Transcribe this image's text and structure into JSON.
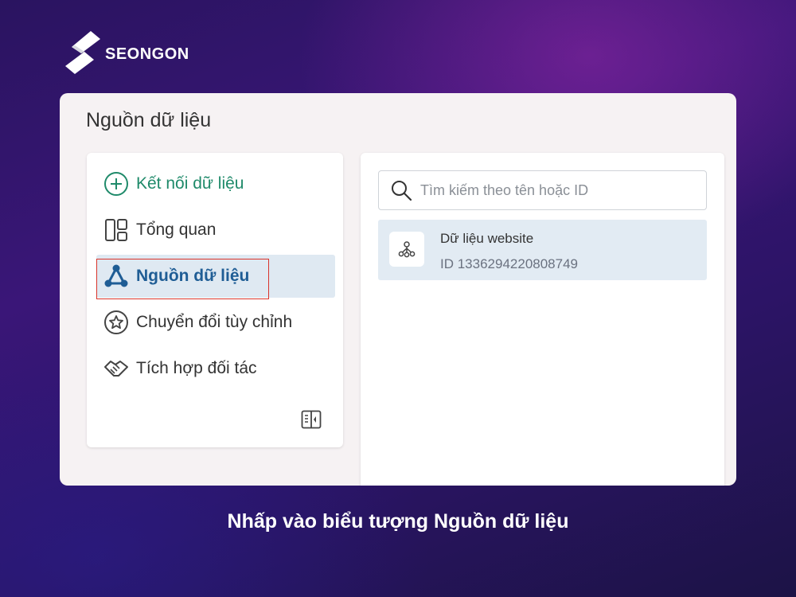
{
  "brand": {
    "name": "SEONGON"
  },
  "card": {
    "title": "Nguồn dữ liệu"
  },
  "sidebar": {
    "items": [
      {
        "label": "Kết nối dữ liệu",
        "icon": "plus-circle-icon"
      },
      {
        "label": "Tổng quan",
        "icon": "layout-icon"
      },
      {
        "label": "Nguồn dữ liệu",
        "icon": "data-source-icon",
        "active": true
      },
      {
        "label": "Chuyển đổi tùy chỉnh",
        "icon": "star-circle-icon"
      },
      {
        "label": "Tích hợp đối tác",
        "icon": "handshake-icon"
      }
    ],
    "collapse_icon": "panel-collapse-icon"
  },
  "main": {
    "search": {
      "placeholder": "Tìm kiếm theo tên hoặc ID"
    },
    "sources": [
      {
        "name": "Dữ liệu website",
        "id": "ID 1336294220808749",
        "icon": "network-icon"
      }
    ]
  },
  "caption": "Nhấp vào biểu tượng Nguồn dữ liệu",
  "colors": {
    "accent_green": "#1f8a6a",
    "active_blue": "#1f5d95",
    "active_bg": "#dfe9f2",
    "highlight_red": "#d9342b"
  }
}
